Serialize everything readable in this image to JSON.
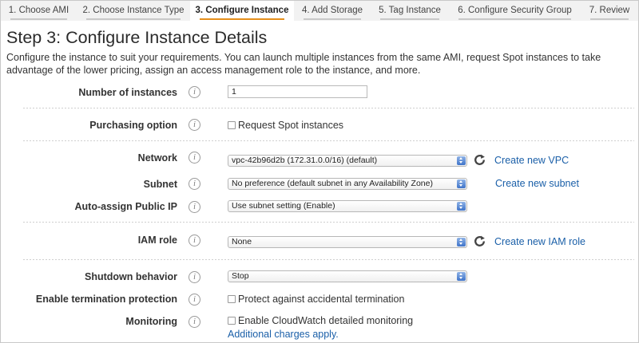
{
  "tabs": [
    {
      "label": "1. Choose AMI",
      "active": false
    },
    {
      "label": "2. Choose Instance Type",
      "active": false
    },
    {
      "label": "3. Configure Instance",
      "active": true
    },
    {
      "label": "4. Add Storage",
      "active": false
    },
    {
      "label": "5. Tag Instance",
      "active": false
    },
    {
      "label": "6. Configure Security Group",
      "active": false
    },
    {
      "label": "7. Review",
      "active": false
    }
  ],
  "page": {
    "title": "Step 3: Configure Instance Details",
    "description": "Configure the instance to suit your requirements. You can launch multiple instances from the same AMI, request Spot instances to take advantage of the lower pricing, assign an access management role to the instance, and more."
  },
  "info_icon": "i",
  "form": {
    "number_of_instances": {
      "label": "Number of instances",
      "value": "1"
    },
    "purchasing_option": {
      "label": "Purchasing option",
      "checkbox_label": "Request Spot instances",
      "checked": false
    },
    "network": {
      "label": "Network",
      "value": "vpc-42b96d2b (172.31.0.0/16) (default)",
      "link": "Create new VPC"
    },
    "subnet": {
      "label": "Subnet",
      "value": "No preference (default subnet in any Availability Zone)",
      "link": "Create new subnet"
    },
    "auto_assign_ip": {
      "label": "Auto-assign Public IP",
      "value": "Use subnet setting (Enable)"
    },
    "iam_role": {
      "label": "IAM role",
      "value": "None",
      "link": "Create new IAM role"
    },
    "shutdown_behavior": {
      "label": "Shutdown behavior",
      "value": "Stop"
    },
    "termination_protection": {
      "label": "Enable termination protection",
      "checkbox_label": "Protect against accidental termination",
      "checked": false
    },
    "monitoring": {
      "label": "Monitoring",
      "checkbox_label": "Enable CloudWatch detailed monitoring",
      "checked": false,
      "note": "Additional charges apply."
    }
  },
  "colors": {
    "active_tab_underline": "#e58f1b",
    "link": "#1a5fa8",
    "select_arrow": "#3f74c9"
  }
}
